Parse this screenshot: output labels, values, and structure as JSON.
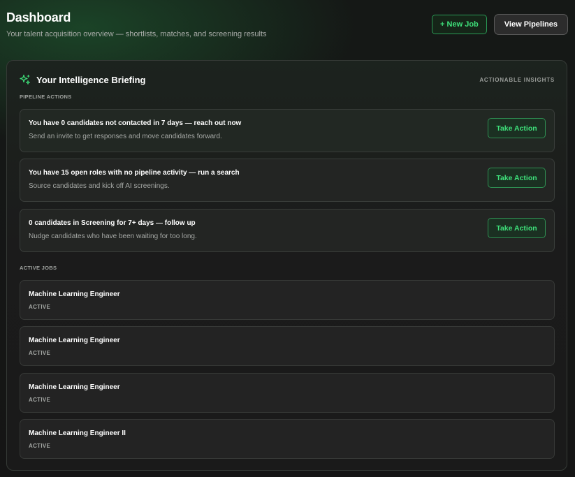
{
  "header": {
    "title": "Dashboard",
    "subtitle": "Your talent acquisition overview — shortlists, matches, and screening results",
    "new_job_label": "+ New Job",
    "view_pipelines_label": "View Pipelines"
  },
  "briefing": {
    "title": "Your Intelligence Briefing",
    "tag": "ACTIONABLE INSIGHTS",
    "icon": "sparkle-icon",
    "pipeline_actions_label": "PIPELINE ACTIONS",
    "actions": [
      {
        "title": "You have 0 candidates not contacted in 7 days — reach out now",
        "description": "Send an invite to get responses and move candidates forward.",
        "button": "Take Action"
      },
      {
        "title": "You have 15 open roles with no pipeline activity — run a search",
        "description": "Source candidates and kick off AI screenings.",
        "button": "Take Action"
      },
      {
        "title": "0 candidates in Screening for 7+ days — follow up",
        "description": "Nudge candidates who have been waiting for too long.",
        "button": "Take Action"
      }
    ],
    "active_jobs_label": "ACTIVE JOBS",
    "jobs": [
      {
        "title": "Machine Learning Engineer",
        "status": "ACTIVE"
      },
      {
        "title": "Machine Learning Engineer",
        "status": "ACTIVE"
      },
      {
        "title": "Machine Learning Engineer",
        "status": "ACTIVE"
      },
      {
        "title": "Machine Learning Engineer II",
        "status": "ACTIVE"
      }
    ]
  },
  "colors": {
    "accent": "#3ee07a",
    "background": "#141414",
    "card": "#232323"
  }
}
